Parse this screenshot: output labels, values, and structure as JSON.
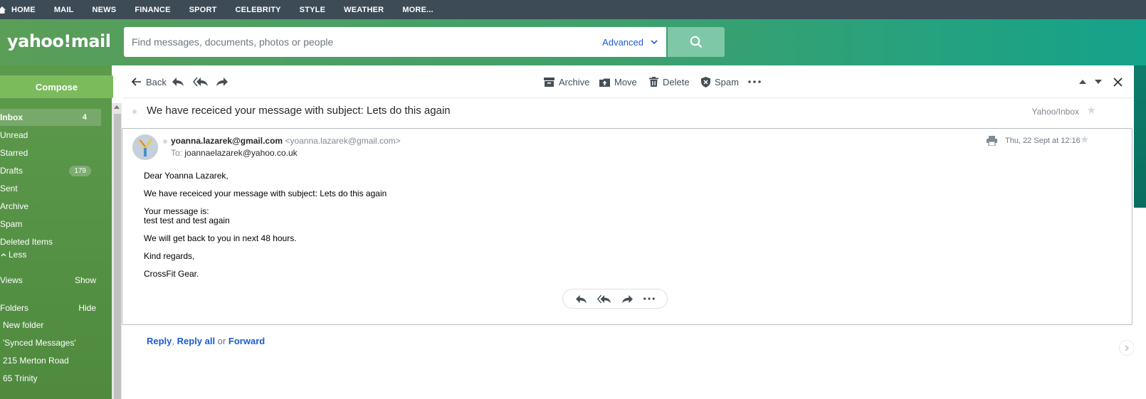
{
  "topnav": {
    "items": [
      "HOME",
      "MAIL",
      "NEWS",
      "FINANCE",
      "SPORT",
      "CELEBRITY",
      "STYLE",
      "WEATHER",
      "MORE..."
    ]
  },
  "header": {
    "logo": "yahoo!mail",
    "search_placeholder": "Find messages, documents, photos or people",
    "advanced_label": "Advanced"
  },
  "sidebar": {
    "compose_label": "Compose",
    "folders": [
      {
        "label": "Inbox",
        "count": "4"
      },
      {
        "label": "Unread"
      },
      {
        "label": "Starred"
      },
      {
        "label": "Drafts",
        "count": "179"
      },
      {
        "label": "Sent"
      },
      {
        "label": "Archive"
      },
      {
        "label": "Spam"
      },
      {
        "label": "Deleted Items"
      },
      {
        "label": "Less"
      }
    ],
    "views_label": "Views",
    "views_action": "Show",
    "folders_label": "Folders",
    "folders_action": "Hide",
    "custom_folders": [
      "New folder",
      "'Synced Messages'",
      "215 Merton Road",
      "65 Trinity"
    ]
  },
  "toolbar": {
    "back_label": "Back",
    "archive_label": "Archive",
    "move_label": "Move",
    "delete_label": "Delete",
    "spam_label": "Spam"
  },
  "message": {
    "subject": "We have receiced your message with subject: Lets do this again",
    "folder_path": "Yahoo/Inbox",
    "sender_name": "yoanna.lazarek@gmail.com",
    "sender_email": "<yoanna.lazarek@gmail.com>",
    "to_label": "To:",
    "to_address": "joannaelazarek@yahoo.co.uk",
    "date": "Thu, 22 Sept at 12:16",
    "body": {
      "greeting": "Dear Yoanna Lazarek,",
      "line1": "We have receiced your message with subject: Lets do this again",
      "line2a": "Your message is:",
      "line2b": "test test and test again",
      "line3": "We will get back to you in next 48 hours.",
      "line4": "Kind regards,",
      "line5": "CrossFit Gear."
    }
  },
  "quick_reply": {
    "reply": "Reply",
    "reply_all": "Reply all",
    "or": "or",
    "forward": "Forward"
  },
  "colors": {
    "accent_blue": "#1a5bd6",
    "sidebar_green": "#5c9a4c",
    "topnav": "#3d4b57"
  }
}
